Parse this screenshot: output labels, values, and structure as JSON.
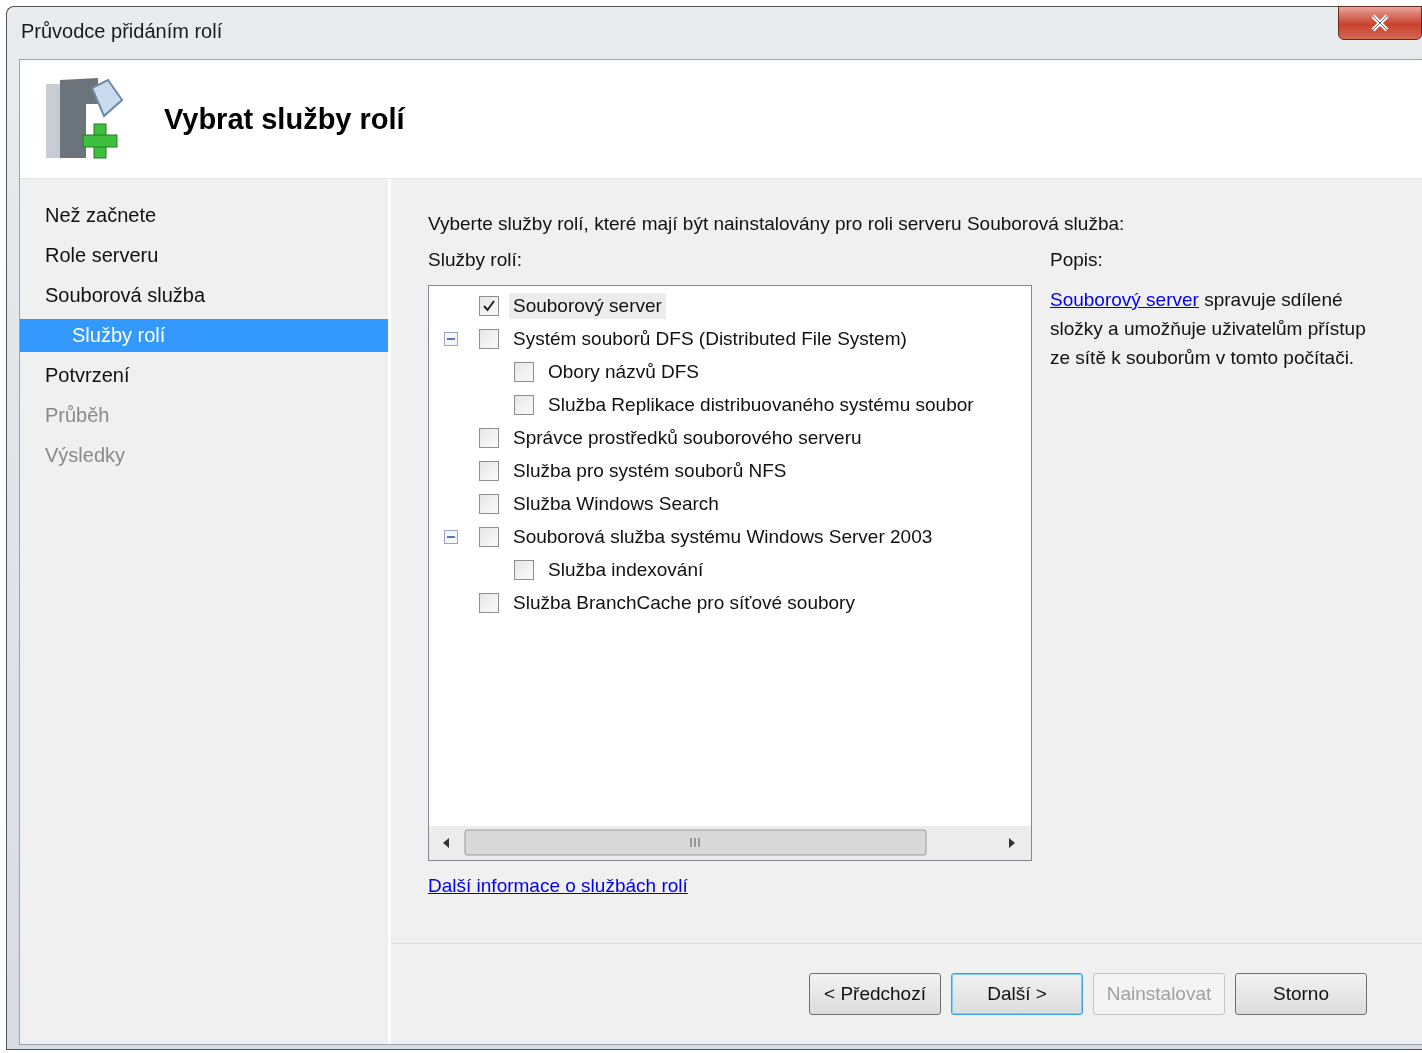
{
  "window": {
    "title": "Průvodce přidáním rolí"
  },
  "header": {
    "title": "Vybrat služby rolí"
  },
  "steps": [
    {
      "label": "Než začnete",
      "selected": false,
      "disabled": false
    },
    {
      "label": "Role serveru",
      "selected": false,
      "disabled": false
    },
    {
      "label": "Souborová služba",
      "selected": false,
      "disabled": false,
      "children": [
        {
          "label": "Služby rolí",
          "selected": true,
          "disabled": false
        }
      ]
    },
    {
      "label": "Potvrzení",
      "selected": false,
      "disabled": false
    },
    {
      "label": "Průběh",
      "selected": false,
      "disabled": true
    },
    {
      "label": "Výsledky",
      "selected": false,
      "disabled": true
    }
  ],
  "instruction": "Vyberte služby rolí, které mají být nainstalovány pro roli serveru Souborová služba:",
  "services": {
    "label": "Služby rolí:",
    "items": [
      {
        "label": "Souborový server",
        "checked": true,
        "selected": true
      },
      {
        "label": "Systém souborů DFS (Distributed File System)",
        "checked": false,
        "selected": false,
        "expanded": true,
        "children": [
          {
            "label": "Obory názvů DFS",
            "checked": false,
            "selected": false
          },
          {
            "label": "Služba Replikace distribuovaného systému soubor",
            "checked": false,
            "selected": false
          }
        ]
      },
      {
        "label": "Správce prostředků souborového serveru",
        "checked": false,
        "selected": false
      },
      {
        "label": "Služba pro systém souborů NFS",
        "checked": false,
        "selected": false
      },
      {
        "label": "Služba Windows Search",
        "checked": false,
        "selected": false
      },
      {
        "label": "Souborová služba systému Windows Server 2003",
        "checked": false,
        "selected": false,
        "expanded": true,
        "children": [
          {
            "label": "Služba indexování",
            "checked": false,
            "selected": false
          }
        ]
      },
      {
        "label": "Služba BranchCache pro síťové soubory",
        "checked": false,
        "selected": false
      }
    ]
  },
  "more_info_link": "Další informace o službách rolí",
  "description": {
    "label": "Popis:",
    "link": "Souborový server",
    "text": " spravuje sdílené složky a umožňuje uživatelům přístup ze sítě k souborům v tomto počítači."
  },
  "buttons": [
    {
      "label": "< Předchozí",
      "disabled": false,
      "default": false
    },
    {
      "label": "Další >",
      "disabled": false,
      "default": true
    },
    {
      "label": "Nainstalovat",
      "disabled": true,
      "default": false
    },
    {
      "label": "Storno",
      "disabled": false,
      "default": false
    }
  ]
}
